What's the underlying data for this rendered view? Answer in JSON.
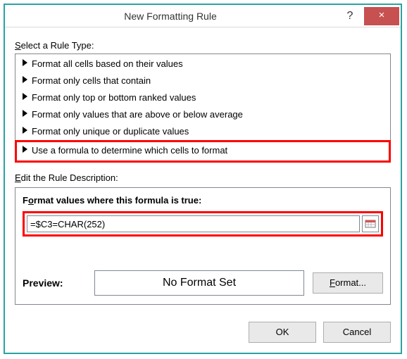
{
  "dialog": {
    "title": "New Formatting Rule",
    "help_symbol": "?",
    "close_symbol": "×"
  },
  "rule_type_label_pre": "S",
  "rule_type_label_post": "elect a Rule Type:",
  "rule_types": [
    "Format all cells based on their values",
    "Format only cells that contain",
    "Format only top or bottom ranked values",
    "Format only values that are above or below average",
    "Format only unique or duplicate values",
    "Use a formula to determine which cells to format"
  ],
  "selected_rule_index": 5,
  "edit_desc_label_pre": "E",
  "edit_desc_label_post": "dit the Rule Description:",
  "formula_header_pre": "F",
  "formula_header_mid": "o",
  "formula_header_post": "rmat values where this formula is true:",
  "formula_value": "=$C3=CHAR(252)",
  "preview_label": "Preview:",
  "preview_text": "No Format Set",
  "format_btn_pre": "F",
  "format_btn_post": "ormat...",
  "ok_label": "OK",
  "cancel_label": "Cancel"
}
